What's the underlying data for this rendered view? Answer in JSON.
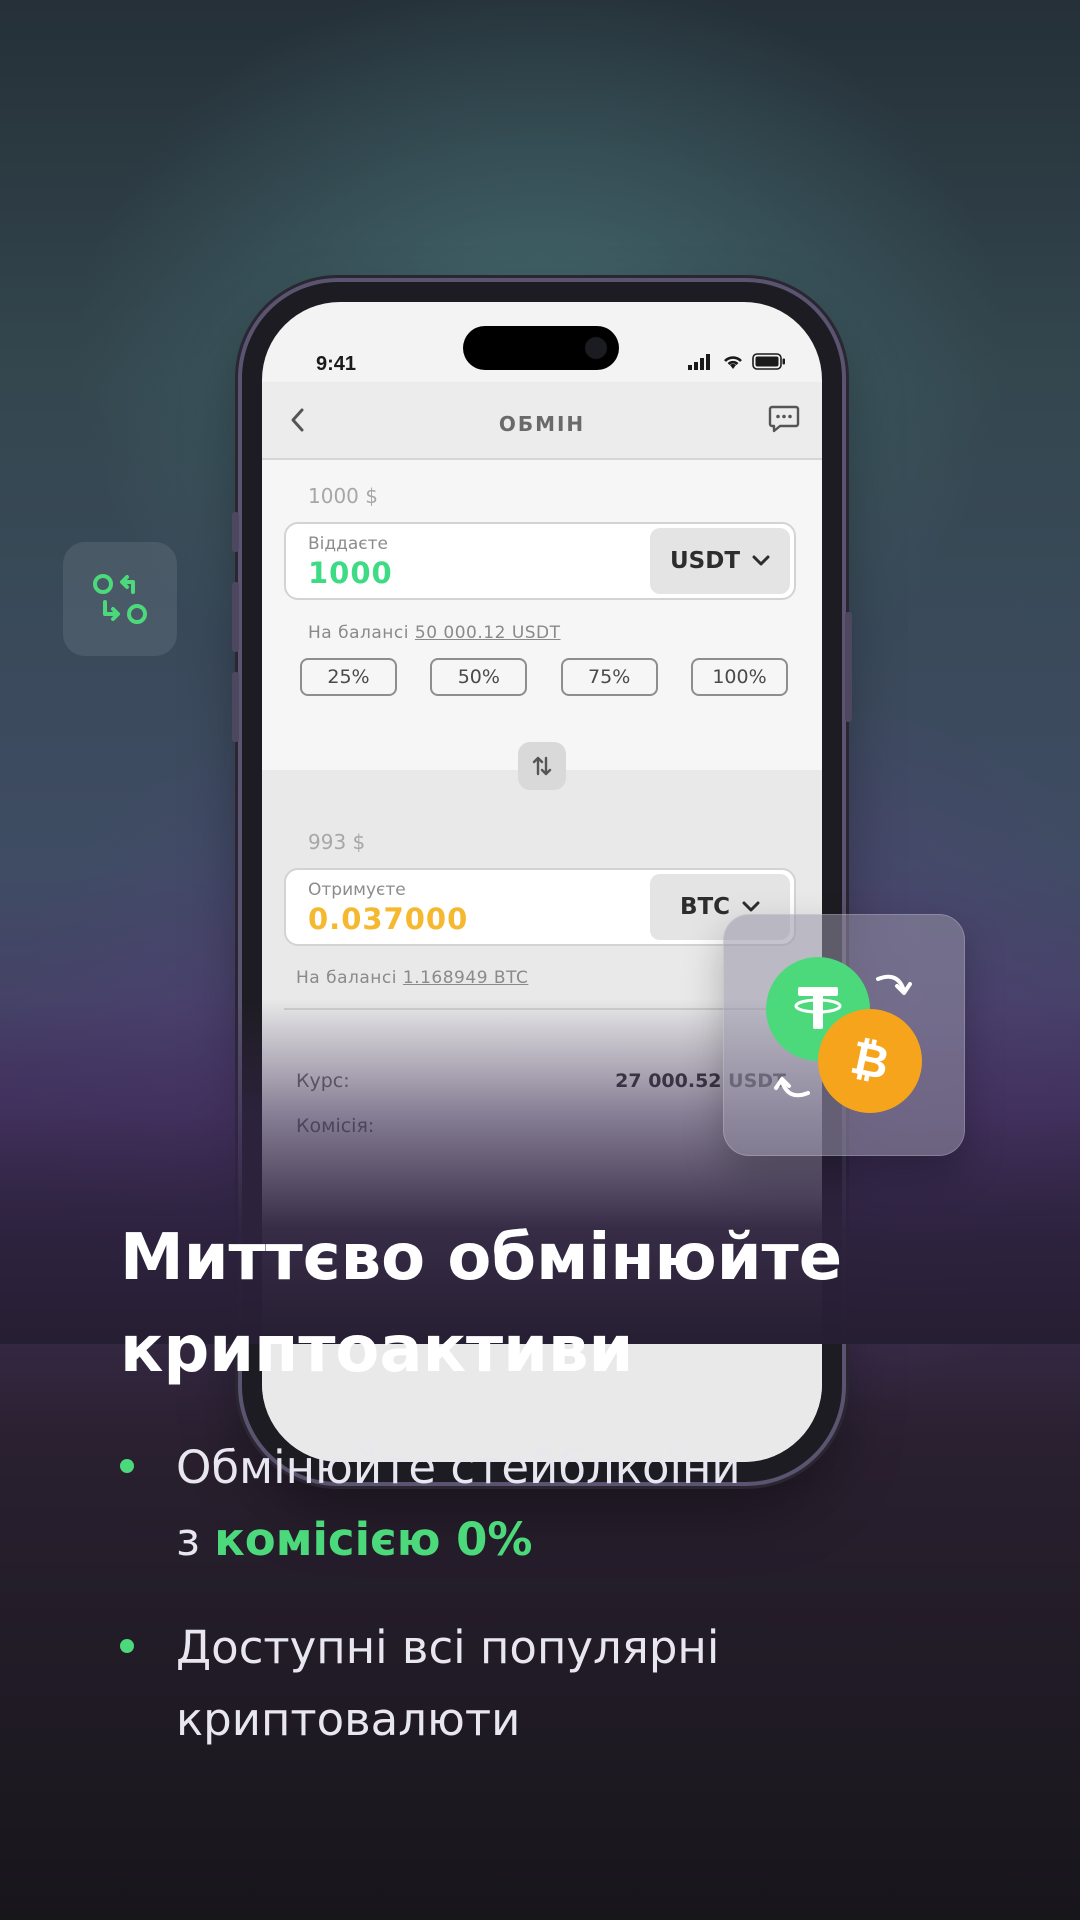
{
  "status_bar": {
    "time": "9:41"
  },
  "navbar": {
    "title": "ОБМІН"
  },
  "give": {
    "usd_hint": "1000 $",
    "label": "Віддаєте",
    "value": "1000",
    "currency": "USDT",
    "balance_prefix": "На балансі",
    "balance_amount": "50 000.12 USDT",
    "value_color": "#3ddc84"
  },
  "percent_buttons": [
    "25%",
    "50%",
    "75%",
    "100%"
  ],
  "receive": {
    "usd_hint": "993 $",
    "label": "Отримуєте",
    "value": "0.037000",
    "currency": "BTC",
    "balance_prefix": "На балансі",
    "balance_amount": "1.168949 BTC",
    "value_color": "#f5b82e"
  },
  "rate": {
    "label": "Курс:",
    "value": "27 000.52 USDT"
  },
  "fee": {
    "label": "Комісія:"
  },
  "headline": {
    "line1": "Миттєво обмінюйте",
    "line2": "криптоактиви"
  },
  "bullets": [
    {
      "line1": "Обмінюйте стейблкоїни",
      "line2_prefix": "з",
      "line2_accent": "комісією 0%"
    },
    {
      "line1": "Доступні всі популярні",
      "line2": "криптовалюти"
    }
  ],
  "colors": {
    "accent": "#4cd97b",
    "btc": "#f7a41d",
    "usdt": "#4cd97b"
  },
  "icons": [
    "exchange-icon",
    "back-chevron-icon",
    "chat-icon",
    "swap-arrows-icon",
    "chevron-down-icon",
    "usdt-coin-icon",
    "btc-coin-icon"
  ]
}
